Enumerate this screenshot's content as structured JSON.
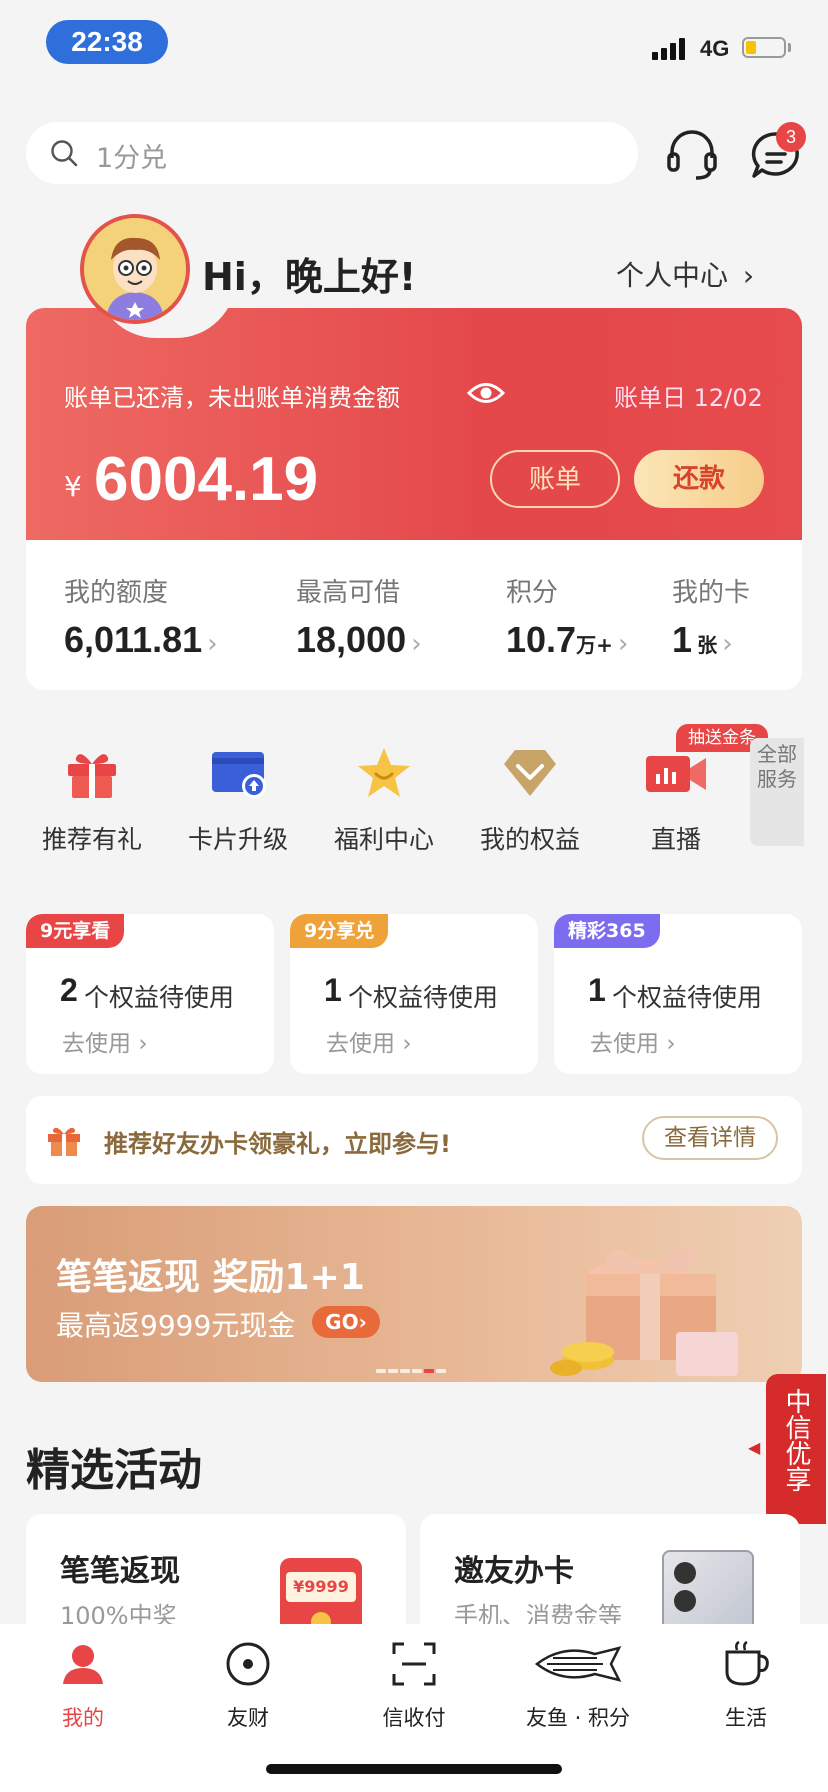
{
  "status_bar": {
    "time": "22:38",
    "network": "4G"
  },
  "search": {
    "placeholder": "1分兑"
  },
  "header": {
    "message_count": "3"
  },
  "greeting": {
    "text": "Hi，晚上好!",
    "personal_center": "个人中心"
  },
  "bill_card": {
    "status_text": "账单已还清，未出账单消费金额",
    "bill_day": "账单日 12/02",
    "currency": "¥",
    "amount": "6004.19",
    "bill_button": "账单",
    "repay_button": "还款"
  },
  "stats": [
    {
      "label": "我的额度",
      "value": "6,011.81",
      "unit": ""
    },
    {
      "label": "最高可借",
      "value": "18,000",
      "unit": ""
    },
    {
      "label": "积分",
      "value": "10.7",
      "unit": "万+"
    },
    {
      "label": "我的卡",
      "value": "1",
      "unit": "张"
    }
  ],
  "quick_menu": {
    "items": [
      {
        "label": "推荐有礼",
        "icon": "gift-icon"
      },
      {
        "label": "卡片升级",
        "icon": "card-upgrade-icon"
      },
      {
        "label": "福利中心",
        "icon": "star-icon"
      },
      {
        "label": "我的权益",
        "icon": "diamond-icon"
      },
      {
        "label": "直播",
        "icon": "live-camera-icon"
      }
    ],
    "live_tag": "抽送金条",
    "all_services": "全部服务"
  },
  "rights_cards": [
    {
      "tag": "9元享看",
      "tag_color": "#e84646",
      "count": "2",
      "text": "个权益待使用",
      "action": "去使用"
    },
    {
      "tag": "9分享兑",
      "tag_color": "#f0a23a",
      "count": "1",
      "text": "个权益待使用",
      "action": "去使用"
    },
    {
      "tag": "精彩365",
      "tag_color": "#7b6cf0",
      "count": "1",
      "text": "个权益待使用",
      "action": "去使用"
    }
  ],
  "referral": {
    "text": "推荐好友办卡领豪礼，立即参与!",
    "button": "查看详情"
  },
  "banner": {
    "title": "笔笔返现  奖励1+1",
    "subtitle": "最高返9999元现金",
    "go": "GO",
    "active_page": 5,
    "total_pages": 6
  },
  "floating": {
    "label": "中信优享"
  },
  "activities": {
    "section_title": "精选活动",
    "cards": [
      {
        "title": "笔笔返现",
        "subtitle": "100%中奖",
        "image_text": "¥9999"
      },
      {
        "title": "邀友办卡",
        "subtitle": "手机、消费金等"
      }
    ]
  },
  "tabbar": [
    {
      "label": "我的",
      "icon": "person-icon",
      "active": true
    },
    {
      "label": "友财",
      "icon": "target-icon",
      "active": false
    },
    {
      "label": "信收付",
      "icon": "scan-icon",
      "active": false
    },
    {
      "label": "友鱼 · 积分",
      "icon": "fish-icon",
      "active": false
    },
    {
      "label": "生活",
      "icon": "cup-icon",
      "active": false
    }
  ],
  "colors": {
    "brand_red": "#e4474a",
    "accent_gold": "#8a6a3c",
    "active_tab": "#e84646"
  }
}
